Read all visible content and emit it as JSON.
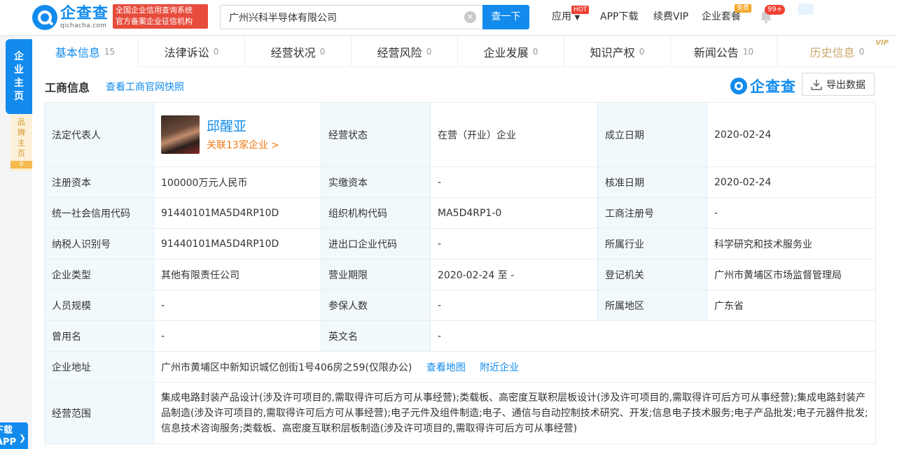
{
  "header": {
    "logo_name": "企查查",
    "logo_sub": "qichacha.com",
    "slogan_line1": "全国企业信用查询系统",
    "slogan_line2": "官方备案企业征信机构",
    "search_value": "广州兴科半导体有限公司",
    "search_button": "查一下",
    "nav": {
      "apps": "应用",
      "apps_tag": "HOT",
      "app_download": "APP下载",
      "vip": "续费VIP",
      "package": "企业套餐",
      "package_tag": "免费",
      "notif_count": "99+"
    }
  },
  "rail": {
    "main": [
      "企",
      "业",
      "主",
      "页"
    ],
    "brand": [
      "品",
      "牌",
      "主",
      "页"
    ],
    "brand_count": "0",
    "download_line1": "下载",
    "download_line2": "APP"
  },
  "tabs": [
    {
      "label": "基本信息",
      "count": "15"
    },
    {
      "label": "法律诉讼",
      "count": "0"
    },
    {
      "label": "经营状况",
      "count": "0"
    },
    {
      "label": "经营风险",
      "count": "0"
    },
    {
      "label": "企业发展",
      "count": "0"
    },
    {
      "label": "知识产权",
      "count": "0"
    },
    {
      "label": "新闻公告",
      "count": "10"
    },
    {
      "label": "历史信息",
      "count": "0",
      "tag": "VIP"
    }
  ],
  "panel": {
    "title": "工商信息",
    "snapshot_link": "查看工商官网快照",
    "brand_logo": "企查查",
    "export_label": "导出数据"
  },
  "info": {
    "legal_rep_label": "法定代表人",
    "legal_rep_name": "邱醒亚",
    "legal_rep_related": "关联13家企业 >",
    "status_label": "经营状态",
    "status_value": "在营（开业）企业",
    "founded_label": "成立日期",
    "founded_value": "2020-02-24",
    "reg_capital_label": "注册资本",
    "reg_capital_value": "100000万元人民币",
    "paid_capital_label": "实缴资本",
    "paid_capital_value": "-",
    "approval_date_label": "核准日期",
    "approval_date_value": "2020-02-24",
    "credit_code_label": "统一社会信用代码",
    "credit_code_value": "91440101MA5D4RP10D",
    "org_code_label": "组织机构代码",
    "org_code_value": "MA5D4RP1-0",
    "biz_reg_no_label": "工商注册号",
    "biz_reg_no_value": "-",
    "taxpayer_id_label": "纳税人识别号",
    "taxpayer_id_value": "91440101MA5D4RP10D",
    "import_export_label": "进出口企业代码",
    "import_export_value": "-",
    "industry_label": "所属行业",
    "industry_value": "科学研究和技术服务业",
    "company_type_label": "企业类型",
    "company_type_value": "其他有限责任公司",
    "term_label": "营业期限",
    "term_value": "2020-02-24 至 -",
    "authority_label": "登记机关",
    "authority_value": "广州市黄埔区市场监督管理局",
    "staff_size_label": "人员规模",
    "staff_size_value": "-",
    "insured_label": "参保人数",
    "insured_value": "-",
    "region_label": "所属地区",
    "region_value": "广东省",
    "former_name_label": "曾用名",
    "former_name_value": "-",
    "english_name_label": "英文名",
    "english_name_value": "-",
    "address_label": "企业地址",
    "address_value": "广州市黄埔区中新知识城亿创街1号406房之59(仅限办公)",
    "address_map_link": "查看地图",
    "address_nearby_link": "附近企业",
    "scope_label": "经营范围",
    "scope_value": "集成电路封装产品设计(涉及许可项目的,需取得许可后方可从事经营);类载板、高密度互联积层板设计(涉及许可项目的,需取得许可后方可从事经营);集成电路封装产品制造(涉及许可项目的,需取得许可后方可从事经营);电子元件及组件制造;电子、通信与自动控制技术研究、开发;信息电子技术服务;电子产品批发;电子元器件批发;信息技术咨询服务;类载板、高密度互联积层板制造(涉及许可项目的,需取得许可后方可从事经营)"
  }
}
